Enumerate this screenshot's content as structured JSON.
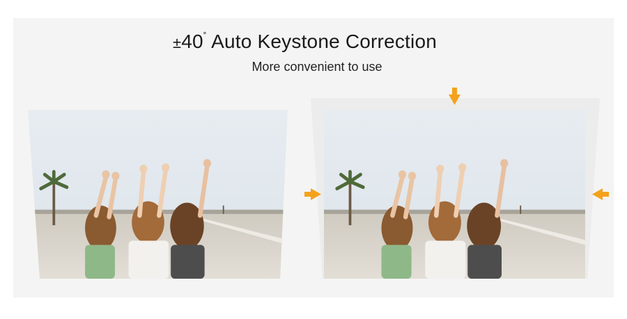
{
  "title": {
    "pm": "±",
    "number": "40",
    "deg": "˚",
    "text": " Auto Keystone Correction"
  },
  "subtitle": "More convenient to use",
  "colors": {
    "background": "#f4f4f4",
    "arrow": "#f4a21c",
    "sky": "#dfe6ec",
    "road": "#d8d4cc"
  },
  "images": {
    "before": "photo-before-keystone",
    "after": "photo-after-keystone"
  },
  "icons": {
    "arrow_top": "arrow-down-icon",
    "arrow_left": "arrow-right-icon",
    "arrow_right": "arrow-left-icon"
  }
}
